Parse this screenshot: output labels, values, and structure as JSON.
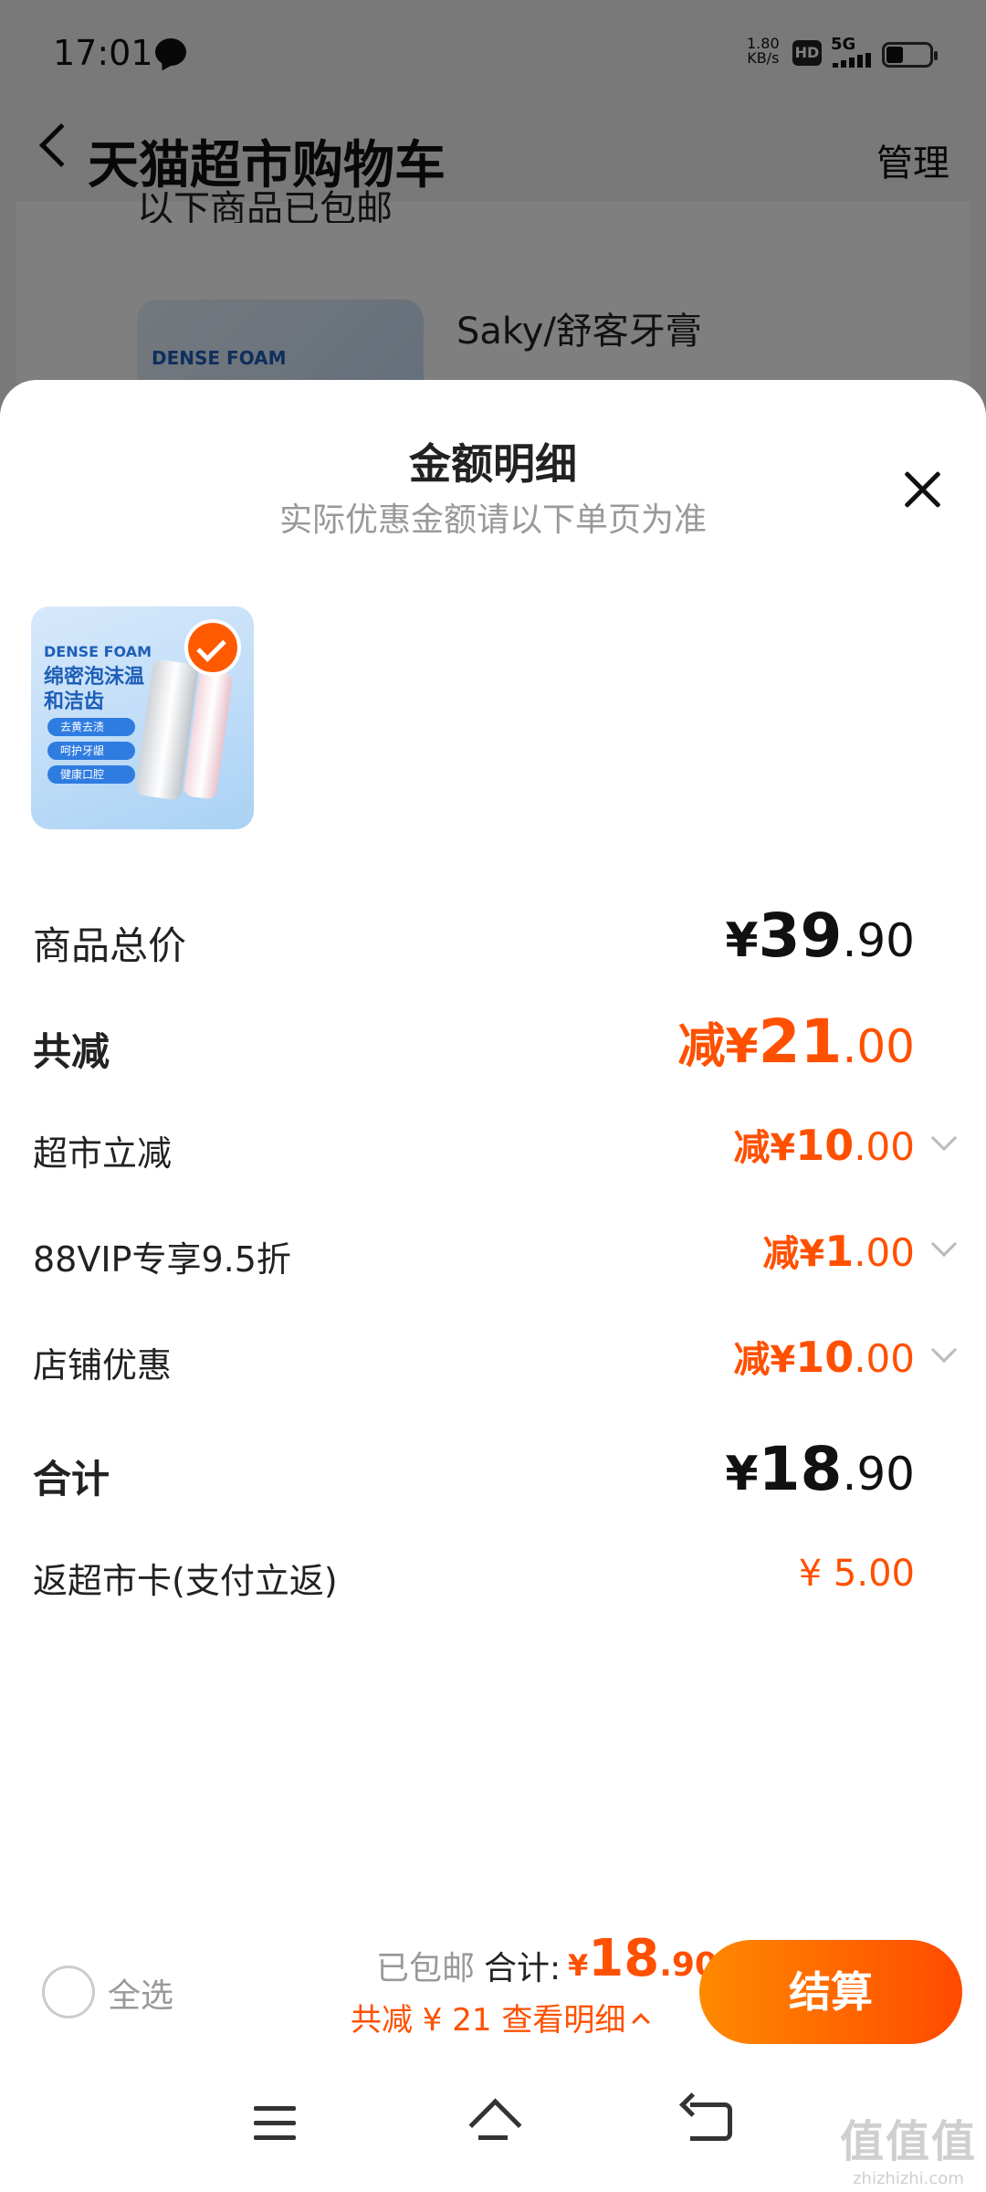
{
  "status_bar": {
    "time": "17:01",
    "net_speed_value": "1.80",
    "net_speed_unit": "KB/s",
    "hd_label": "HD",
    "network_type": "5G"
  },
  "nav": {
    "title": "天猫超市购物车",
    "manage_label": "管理"
  },
  "background": {
    "shipping_note": "以下商品已包邮",
    "product_name": "Saky/舒客牙膏",
    "product_brand": "DENSE FOAM"
  },
  "sheet": {
    "title": "金额明细",
    "subtitle": "实际优惠金额请以下单页为准",
    "thumbnail": {
      "brand": "DENSE FOAM",
      "headline": "绵密泡沫温和洁齿",
      "features": [
        "去黄去渍",
        "呵护牙龈",
        "健康口腔"
      ]
    },
    "rows": [
      {
        "label": "商品总价",
        "currency": "¥",
        "integer": "39",
        "decimal": ".90",
        "prefix": ""
      },
      {
        "label": "共减",
        "currency": "¥",
        "integer": "21",
        "decimal": ".00",
        "prefix": "减"
      },
      {
        "label": "超市立减",
        "currency": "¥",
        "integer": "10",
        "decimal": ".00",
        "prefix": "减"
      },
      {
        "label": "88VIP专享9.5折",
        "currency": "¥",
        "integer": "1",
        "decimal": ".00",
        "prefix": "减"
      },
      {
        "label": "店铺优惠",
        "currency": "¥",
        "integer": "10",
        "decimal": ".00",
        "prefix": "减"
      },
      {
        "label": "合计",
        "currency": "¥",
        "integer": "18",
        "decimal": ".90",
        "prefix": ""
      },
      {
        "label": "返超市卡(支付立返)",
        "value": "¥ 5.00"
      }
    ]
  },
  "checkout": {
    "select_all_label": "全选",
    "shipping_label": "已包邮",
    "total_label": "合计:",
    "total_currency": "¥",
    "total_integer": "18",
    "total_decimal": ".90",
    "savings_text": "共减 ¥ 21  查看明细",
    "button_label": "结算"
  },
  "watermark": {
    "main": "值值值",
    "sub": "zhizhizhi.com"
  },
  "colors": {
    "accent": "#ff5000",
    "overlay": "rgba(0,0,0,0.5)"
  }
}
